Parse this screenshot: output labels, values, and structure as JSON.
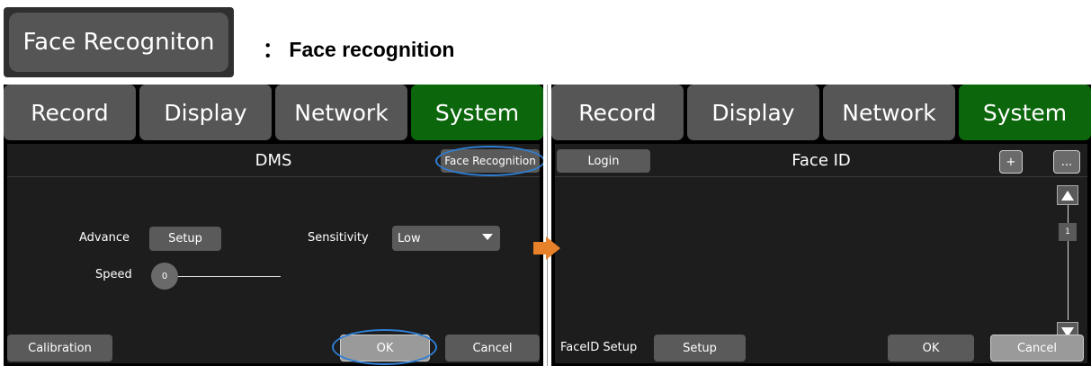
{
  "caption": {
    "button_label": "Face Recogniton",
    "separator": "：",
    "text": "Face recognition"
  },
  "tabs": [
    "Record",
    "Display",
    "Network",
    "System"
  ],
  "active_tab": "System",
  "left_screen": {
    "title": "DMS",
    "face_recognition_button": "Face Recognition",
    "advance_label": "Advance",
    "setup_button": "Setup",
    "sensitivity_label": "Sensitivity",
    "sensitivity_value": "Low",
    "speed_label": "Speed",
    "speed_value": "0",
    "calibration_button": "Calibration",
    "ok_button": "OK",
    "cancel_button": "Cancel"
  },
  "right_screen": {
    "title": "Face ID",
    "login_button": "Login",
    "add_button": "+",
    "more_button": "...",
    "page_number": "1",
    "faceid_setup_label": "FaceID Setup",
    "setup_button": "Setup",
    "ok_button": "OK",
    "cancel_button": "Cancel"
  },
  "colors": {
    "active_tab": "#0c660c",
    "highlight_ellipse": "#2e7fd6",
    "arrow": "#e8822a"
  }
}
